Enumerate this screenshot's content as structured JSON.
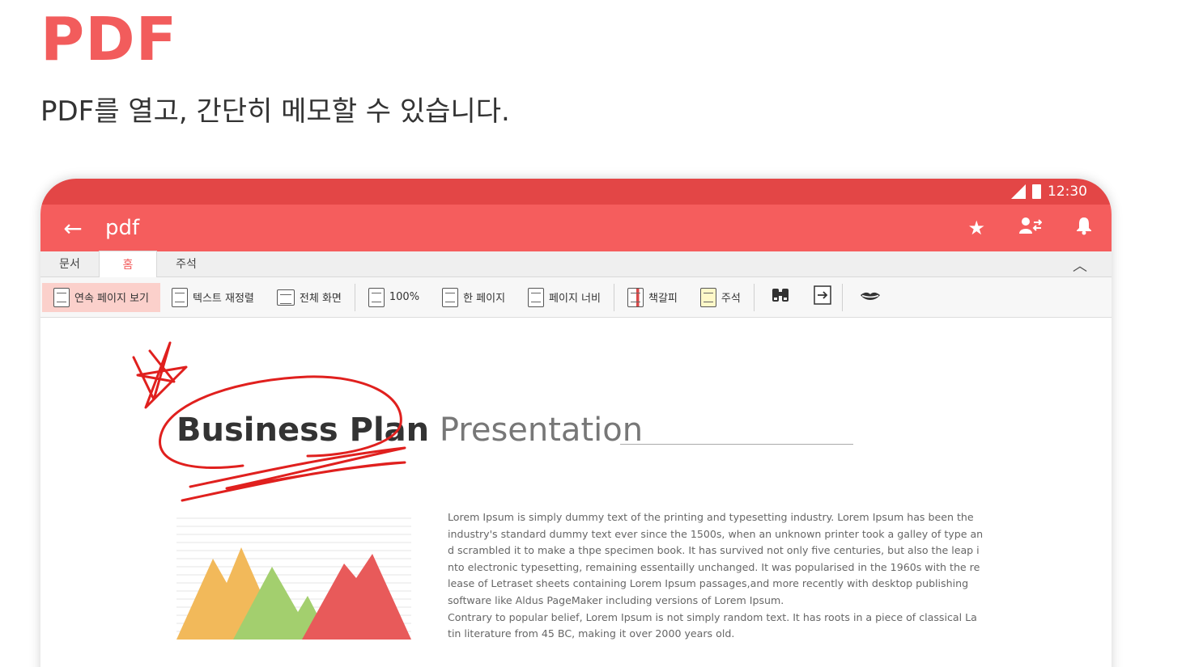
{
  "hero": {
    "title": "PDF",
    "subtitle": "PDF를 열고, 간단히 메모할 수 있습니다."
  },
  "status_bar": {
    "time": "12:30"
  },
  "app_bar": {
    "title": "pdf",
    "back_icon": "arrow-left-icon",
    "actions": [
      "star-icon",
      "person-swap-icon",
      "bell-icon"
    ]
  },
  "tabs": [
    {
      "label": "문서"
    },
    {
      "label": "홈",
      "active": true
    },
    {
      "label": "주석"
    }
  ],
  "toolbar": {
    "items": [
      {
        "label": "연속 페이지 보기",
        "active": true
      },
      {
        "label": "텍스트 재정렬"
      },
      {
        "label": "전체 화면"
      },
      {
        "label": "100%"
      },
      {
        "label": "한 페이지"
      },
      {
        "label": "페이지 너비"
      },
      {
        "label": "책갈피"
      },
      {
        "label": "주석"
      }
    ],
    "icons": [
      "binoculars-icon",
      "export-icon",
      "lips-icon"
    ]
  },
  "document": {
    "heading_bold": "Business Plan",
    "heading_light": " Presentation",
    "body_lines": [
      "Lorem Ipsum is simply dummy text of the printing and typesetting industry. Lorem Ipsum has been the",
      "industry's standard dummy text ever since the 1500s, when an unknown printer took a galley of type an",
      "d scrambled it to make a thpe specimen book. It has survived not only five centuries, but also the leap i",
      "nto electronic typesetting, remaining essentailly unchanged. It was popularised in the 1960s with the re",
      "lease of Letraset sheets containing Lorem Ipsum passages,and more recently with desktop publishing",
      "software like Aldus PageMaker including versions of Lorem Ipsum.",
      "Contrary to popular belief, Lorem Ipsum is not simply random text. It has roots in a piece of classical La",
      "tin literature from 45 BC, making it over 2000 years old."
    ]
  },
  "colors": {
    "accent": "#f25c5c",
    "status_bar": "#e34646",
    "app_bar": "#f55d5d",
    "ink": "#e0201e",
    "mountain_orange": "#f2b95a",
    "mountain_green": "#a3cf6e",
    "mountain_red": "#e85a5a"
  }
}
